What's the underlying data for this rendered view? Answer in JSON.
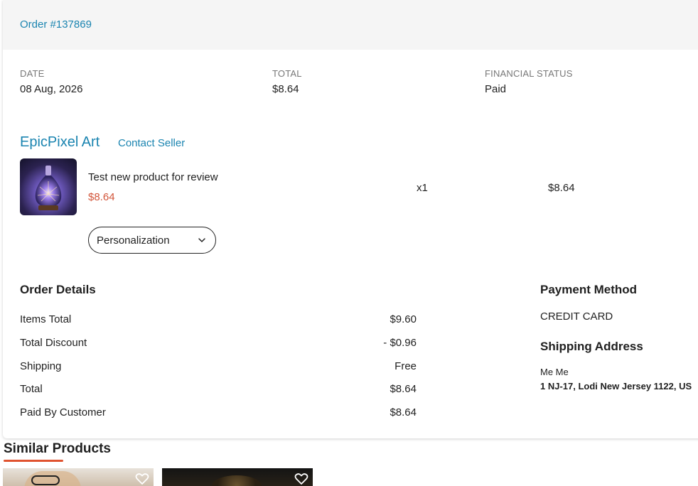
{
  "order": {
    "number_label": "Order #137869",
    "date_label": "DATE",
    "date_value": "08 Aug, 2026",
    "total_label": "TOTAL",
    "total_value": "$8.64",
    "status_label": "FINANCIAL STATUS",
    "status_value": "Paid"
  },
  "seller": {
    "name": "EpicPixel Art",
    "contact_label": "Contact Seller"
  },
  "line_item": {
    "title": "Test new product for review",
    "price": "$8.64",
    "quantity": "x1",
    "line_total": "$8.64",
    "personalization_label": "Personalization"
  },
  "order_details": {
    "title": "Order Details",
    "rows": [
      {
        "label": "Items Total",
        "value": "$9.60"
      },
      {
        "label": "Total Discount",
        "value": "- $0.96"
      },
      {
        "label": "Shipping",
        "value": "Free"
      },
      {
        "label": "Total",
        "value": "$8.64"
      },
      {
        "label": "Paid By Customer",
        "value": "$8.64"
      }
    ]
  },
  "payment": {
    "title": "Payment Method",
    "value": "CREDIT CARD"
  },
  "shipping": {
    "title": "Shipping Address",
    "name": "Me Me",
    "address": "1 NJ-17, Lodi New Jersey 1122, US"
  },
  "similar": {
    "title": "Similar Products"
  },
  "colors": {
    "link_blue": "#1a84b0",
    "price_red": "#d2553a",
    "accent_orange": "#e0532f"
  },
  "icons": {
    "dropdown": "chevron-down-icon",
    "favorite": "heart-icon"
  }
}
